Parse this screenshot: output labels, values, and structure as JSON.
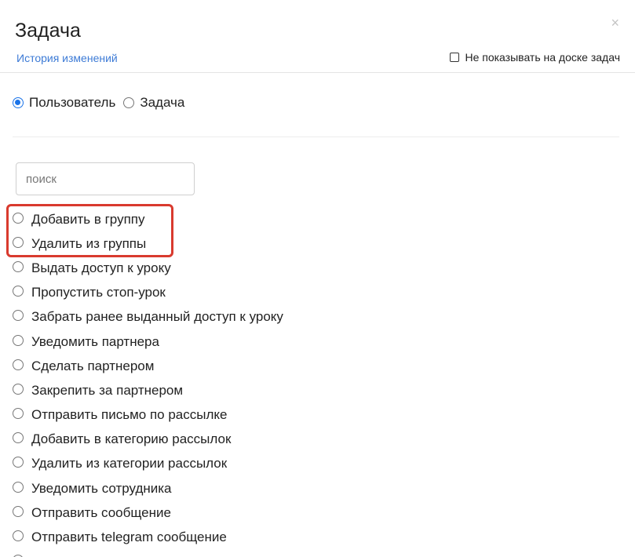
{
  "modal": {
    "title": "Задача",
    "close_glyph": "×",
    "history_link": "История изменений",
    "hide_on_board_label": "Не показывать на доске задач"
  },
  "type_switch": {
    "options": [
      {
        "label": "Пользователь",
        "checked": true
      },
      {
        "label": "Задача",
        "checked": false
      }
    ]
  },
  "search": {
    "placeholder": "поиск",
    "value": ""
  },
  "actions": [
    {
      "label": "Добавить в группу"
    },
    {
      "label": "Удалить из группы"
    },
    {
      "label": "Выдать доступ к уроку"
    },
    {
      "label": "Пропустить стоп-урок"
    },
    {
      "label": "Забрать ранее выданный доступ к уроку"
    },
    {
      "label": "Уведомить партнера"
    },
    {
      "label": "Сделать партнером"
    },
    {
      "label": "Закрепить за партнером"
    },
    {
      "label": "Отправить письмо по рассылке"
    },
    {
      "label": "Добавить в категорию рассылок"
    },
    {
      "label": "Удалить из категории рассылок"
    },
    {
      "label": "Уведомить сотрудника"
    },
    {
      "label": "Отправить сообщение"
    },
    {
      "label": "Отправить telegram сообщение"
    },
    {
      "label": ""
    }
  ],
  "colors": {
    "accent": "#1a73e8",
    "link": "#3d7bd6",
    "highlight": "#d93a2e"
  }
}
